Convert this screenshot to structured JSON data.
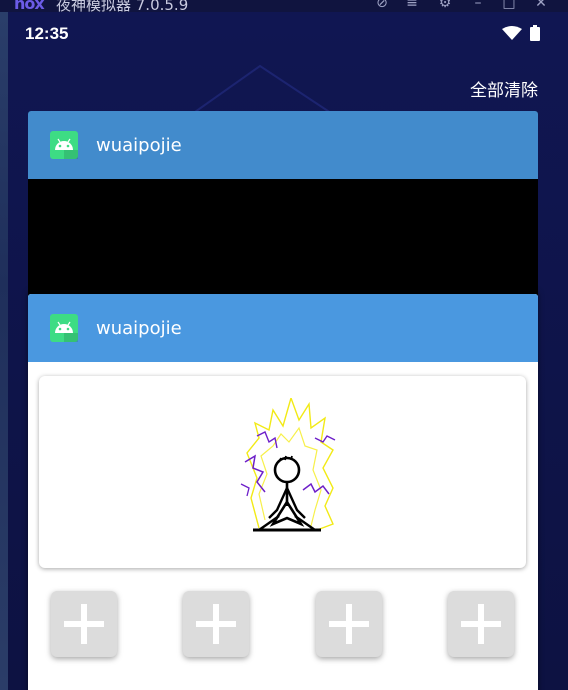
{
  "emulator": {
    "logo": "nox",
    "title": "夜神模拟器 7.0.5.9",
    "controls": [
      "help-icon",
      "menu-icon",
      "settings-icon",
      "minimize-icon",
      "maximize-icon",
      "close-icon"
    ]
  },
  "status_bar": {
    "time": "12:35",
    "icons": [
      "wifi-icon",
      "battery-icon"
    ]
  },
  "recents": {
    "clear_all_label": "全部清除",
    "cards": [
      {
        "app_name": "wuaipojie",
        "icon": "android-icon",
        "header_color": "#428bcc"
      },
      {
        "app_name": "wuaipojie",
        "icon": "android-icon",
        "header_color": "#4a98e0"
      }
    ]
  },
  "app_content": {
    "image": "stick-figure-lightning-drawing",
    "buttons": [
      {
        "icon": "plus-icon"
      },
      {
        "icon": "plus-icon"
      },
      {
        "icon": "plus-icon"
      },
      {
        "icon": "plus-icon"
      }
    ]
  },
  "colors": {
    "background": "#0d1242",
    "card_header_1": "#428bcc",
    "card_header_2": "#4a98e0",
    "android_green": "#3ddc84"
  }
}
